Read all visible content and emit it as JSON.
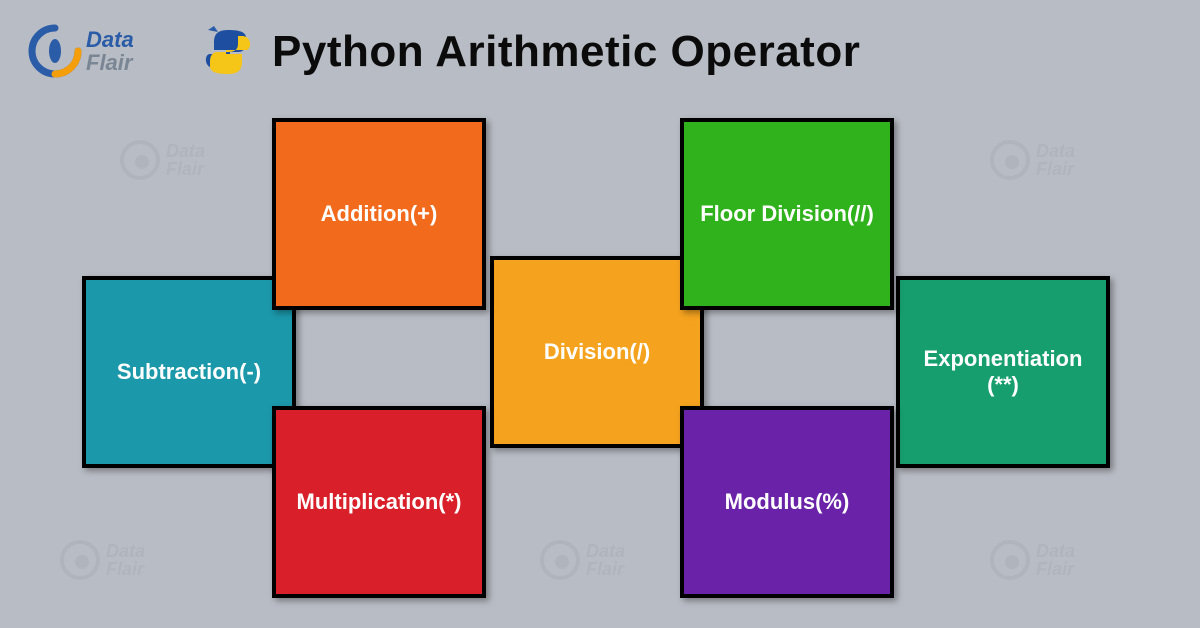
{
  "logo": {
    "line1": "Data",
    "line2": "Flair"
  },
  "title": "Python Arithmetic Operator",
  "tiles": {
    "subtraction": {
      "label": "Subtraction(-)",
      "color": "#1b98aa"
    },
    "addition": {
      "label": "Addition(+)",
      "color": "#f26a1b"
    },
    "multiplication": {
      "label": "Multiplication(*)",
      "color": "#d81f2a"
    },
    "division": {
      "label": "Division(/)",
      "color": "#f5a31e"
    },
    "floordiv": {
      "label": "Floor Division(//)",
      "color": "#2fb21c"
    },
    "modulus": {
      "label": "Modulus(%)",
      "color": "#6a23a8"
    },
    "exponent": {
      "label": "Exponentiation (**)",
      "color": "#169e6e"
    }
  },
  "watermark": {
    "line1": "Data",
    "line2": "Flair"
  }
}
